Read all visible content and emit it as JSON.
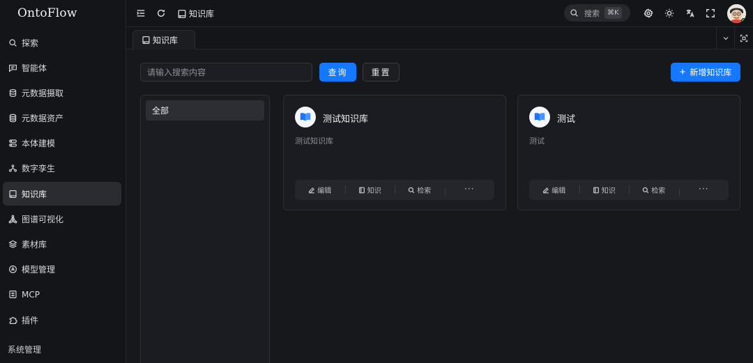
{
  "app": {
    "title": "OntoFlow"
  },
  "sidebar": {
    "items": [
      {
        "label": "探索",
        "icon": "search-icon",
        "active": false
      },
      {
        "label": "智能体",
        "icon": "message-square-icon",
        "active": false
      },
      {
        "label": "元数据摄取",
        "icon": "database-import-icon",
        "active": false
      },
      {
        "label": "元数据资产",
        "icon": "database-icon",
        "active": false
      },
      {
        "label": "本体建模",
        "icon": "layers-model-icon",
        "active": false
      },
      {
        "label": "数字孪生",
        "icon": "node-tree-icon",
        "active": false
      },
      {
        "label": "知识库",
        "icon": "book-icon",
        "active": true
      },
      {
        "label": "图谱可视化",
        "icon": "graph-icon",
        "active": false
      },
      {
        "label": "素材库",
        "icon": "stack-icon",
        "active": false
      },
      {
        "label": "模型管理",
        "icon": "model-icon",
        "active": false
      },
      {
        "label": "MCP",
        "icon": "server-icon",
        "active": false
      },
      {
        "label": "插件",
        "icon": "puzzle-icon",
        "active": false
      }
    ],
    "section_title": "系统管理"
  },
  "header": {
    "breadcrumb": "知识库",
    "search_label": "搜索",
    "search_shortcut": "⌘K"
  },
  "tabs": [
    {
      "label": "知识库"
    }
  ],
  "toolbar": {
    "search_placeholder": "请输入搜索内容",
    "search_value": "",
    "query_label": "查询",
    "reset_label": "重置",
    "new_label": "新增知识库"
  },
  "categories": [
    {
      "label": "全部",
      "selected": true
    }
  ],
  "cards": [
    {
      "title": "测试知识库",
      "description": "测试知识库"
    },
    {
      "title": "测试",
      "description": "测试"
    }
  ],
  "card_actions": {
    "edit": "编辑",
    "knowledge": "知识",
    "retrieve": "检索",
    "more": "···"
  },
  "colors": {
    "primary": "#1677ff",
    "background": "#17181c",
    "sidebar": "#141518",
    "online": "#2fbf55"
  }
}
